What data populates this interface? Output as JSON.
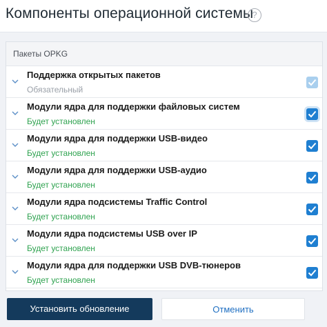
{
  "header": {
    "title": "Компоненты операционной системы",
    "help_glyph": "?"
  },
  "panel": {
    "title": "Пакеты OPKG"
  },
  "packages": [
    {
      "name": "Поддержка открытых пакетов",
      "status": "Обязательный",
      "checked": true,
      "disabled": true
    },
    {
      "name": "Модули ядра для поддержки файловых систем",
      "status": "Будет установлен",
      "checked": true,
      "disabled": false
    },
    {
      "name": "Модули ядра для поддержки USB-видео",
      "status": "Будет установлен",
      "checked": true,
      "disabled": false
    },
    {
      "name": "Модули ядра для поддержки USB-аудио",
      "status": "Будет установлен",
      "checked": true,
      "disabled": false
    },
    {
      "name": "Модули ядра подсистемы Traffic Control",
      "status": "Будет установлен",
      "checked": true,
      "disabled": false
    },
    {
      "name": "Модули ядра подсистемы USB over IP",
      "status": "Будет установлен",
      "checked": true,
      "disabled": false
    },
    {
      "name": "Модули ядра для поддержки USB DVB-тюнеров",
      "status": "Будет установлен",
      "checked": true,
      "disabled": false
    }
  ],
  "actions": {
    "install_label": "Установить обновление",
    "cancel_label": "Отменить"
  },
  "colors": {
    "accent": "#1f7fd1",
    "primary_button": "#143a5c",
    "status_ok": "#2ea24f",
    "status_required": "#9aa0a8"
  }
}
